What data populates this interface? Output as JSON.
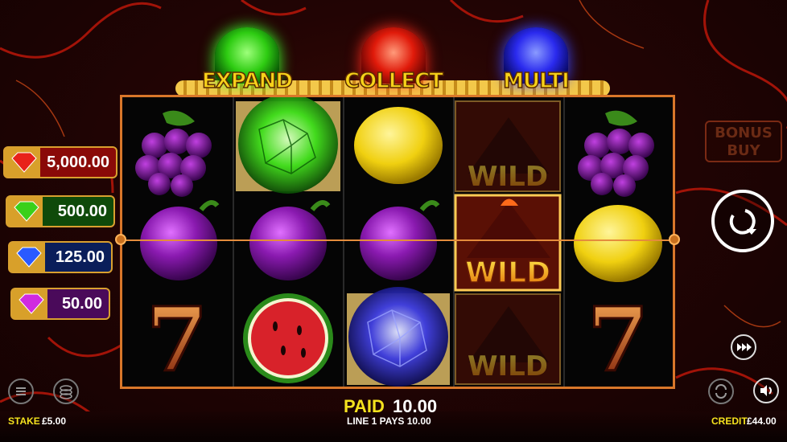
{
  "features": [
    {
      "label": "EXPAND",
      "color": "#3cff2a",
      "label_color": "#f7d21a"
    },
    {
      "label": "COLLECT",
      "color": "#ff2a1a",
      "label_color": "#f7d21a"
    },
    {
      "label": "MULTI",
      "color": "#3a46ff",
      "label_color": "#f7d21a"
    }
  ],
  "jackpots": [
    {
      "value": "5,000.00",
      "gem": "red-diamond-icon",
      "color": "#c01a10"
    },
    {
      "value": "500.00",
      "gem": "green-diamond-icon",
      "color": "#1f7a12"
    },
    {
      "value": "125.00",
      "gem": "blue-diamond-icon",
      "color": "#12357a"
    },
    {
      "value": "50.00",
      "gem": "purple-diamond-icon",
      "color": "#6a1280"
    }
  ],
  "reels": [
    [
      "grapes",
      "plum",
      "seven"
    ],
    [
      "green-orb",
      "plum",
      "watermelon"
    ],
    [
      "lemon",
      "plum",
      "blue-orb"
    ],
    [
      "wild",
      "wild",
      "wild"
    ],
    [
      "grapes",
      "lemon",
      "seven"
    ]
  ],
  "wild_label": "WILD",
  "bonus_buy": {
    "line1": "BONUS",
    "line2": "BUY"
  },
  "status": {
    "paid_label": "PAID",
    "paid_value": "10.00",
    "line_pays": "LINE 1 PAYS 10.00"
  },
  "stake": {
    "label": "STAKE",
    "value": "£5.00"
  },
  "credit": {
    "label": "CREDIT",
    "value": "£44.00"
  },
  "seven_label": "7"
}
